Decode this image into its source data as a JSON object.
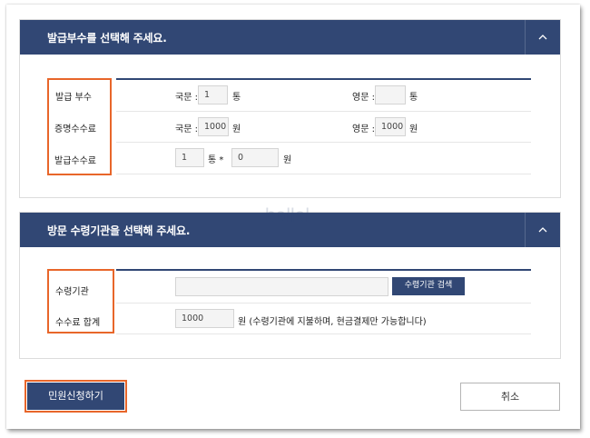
{
  "section1": {
    "title": "발급부수를 선택해 주세요.",
    "rows": {
      "copies": {
        "label": "발급 부수",
        "domestic_label": "국문 :",
        "domestic_value": "1",
        "unit": "통",
        "english_label": "영문 :",
        "english_value": "",
        "english_unit": "통"
      },
      "cert_fee": {
        "label": "증명수수료",
        "domestic_label": "국문 :",
        "domestic_value": "1000",
        "unit": "원",
        "english_label": "영문 :",
        "english_value": "1000",
        "english_unit": "원"
      },
      "issue_fee": {
        "label": "발급수수료",
        "count_value": "1",
        "count_unit": "통 *",
        "fee_value": "0",
        "fee_unit": "원"
      }
    }
  },
  "section2": {
    "title": "방문 수령기관을 선택해 주세요.",
    "rows": {
      "institution": {
        "label": "수령기관",
        "value": "",
        "search_label": "수령기관 검색"
      },
      "total": {
        "label": "수수료 합계",
        "value": "1000",
        "note": "원 (수령기관에 지불하며, 현금결제만 가능합니다)"
      }
    }
  },
  "footer": {
    "apply_label": "민원신청하기",
    "cancel_label": "취소"
  },
  "watermark": "ballal",
  "colors": {
    "header_bg": "#314774",
    "highlight": "#e8662a"
  }
}
